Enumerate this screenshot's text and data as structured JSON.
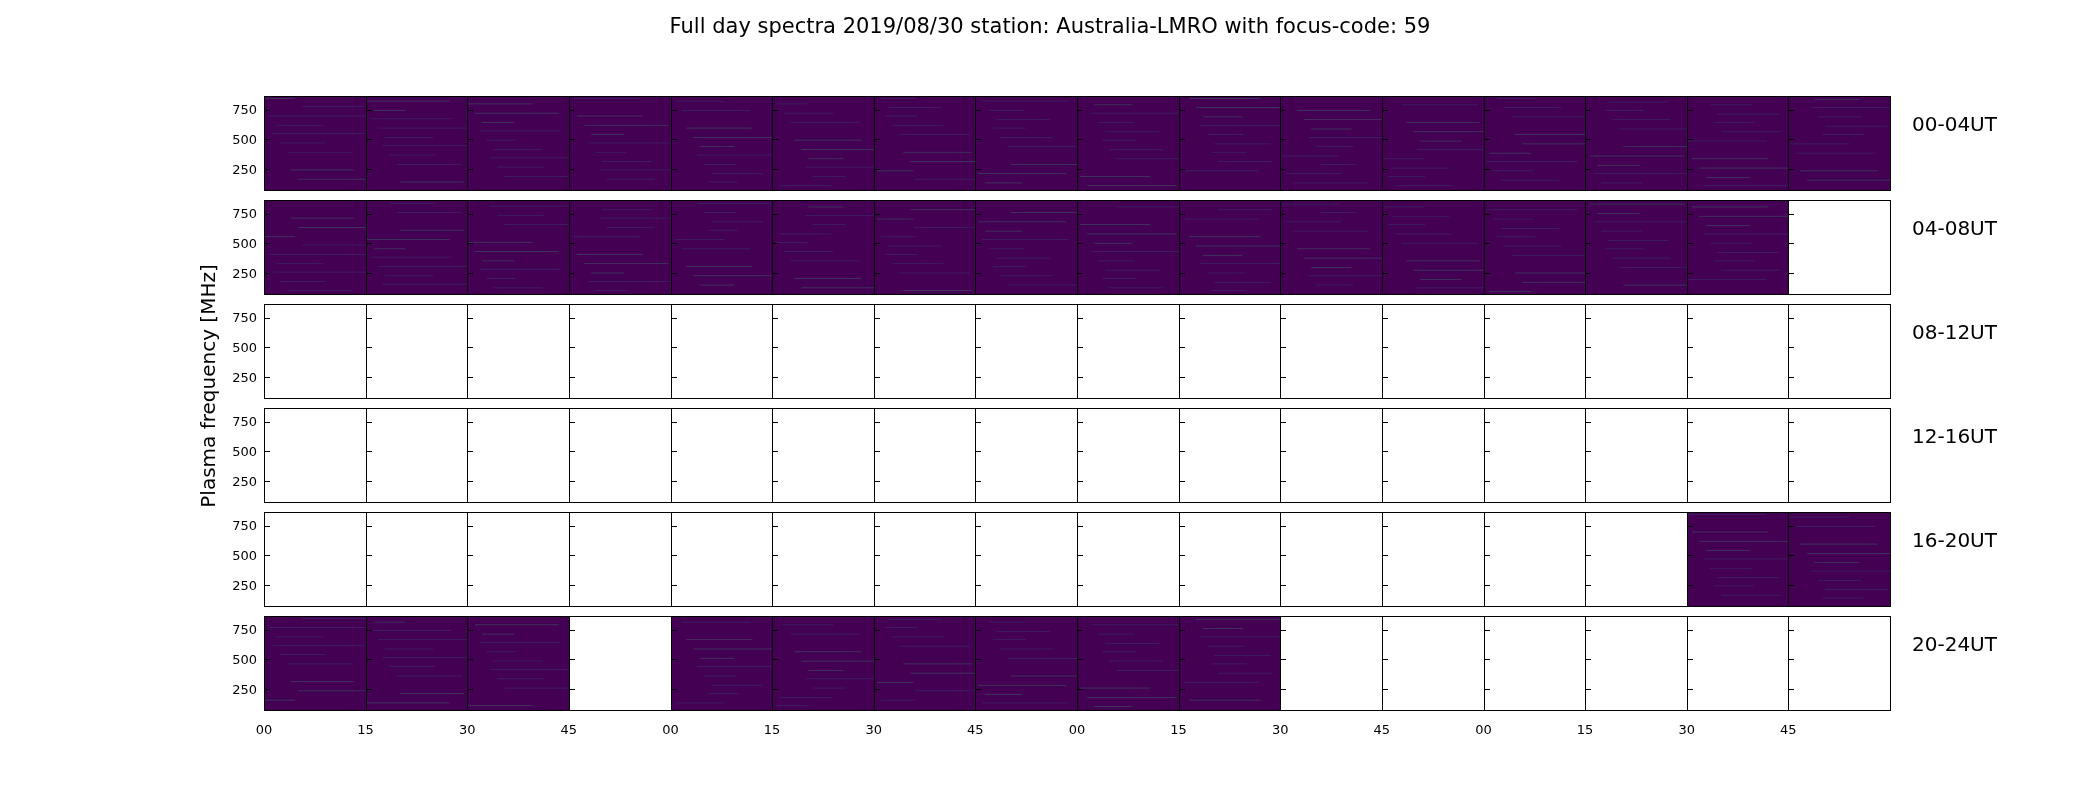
{
  "title": "Full day spectra 2019/08/30 station: Australia-LMRO with focus-code: 59",
  "y_axis": {
    "label": "Plasma frequency [MHz]"
  },
  "rows": [
    {
      "label": "00-04UT",
      "y_ticks": [
        "750",
        "500",
        "250"
      ],
      "panels": [
        {
          "has_data": true
        },
        {
          "has_data": true
        },
        {
          "has_data": true
        },
        {
          "has_data": true
        },
        {
          "has_data": true
        },
        {
          "has_data": true
        },
        {
          "has_data": true
        },
        {
          "has_data": true
        },
        {
          "has_data": true
        },
        {
          "has_data": true
        },
        {
          "has_data": true
        },
        {
          "has_data": true
        },
        {
          "has_data": true
        },
        {
          "has_data": true
        },
        {
          "has_data": true
        },
        {
          "has_data": true
        }
      ]
    },
    {
      "label": "04-08UT",
      "y_ticks": [
        "750",
        "500",
        "250"
      ],
      "panels": [
        {
          "has_data": true
        },
        {
          "has_data": true
        },
        {
          "has_data": true
        },
        {
          "has_data": true
        },
        {
          "has_data": true
        },
        {
          "has_data": true
        },
        {
          "has_data": true
        },
        {
          "has_data": true
        },
        {
          "has_data": true
        },
        {
          "has_data": true
        },
        {
          "has_data": true
        },
        {
          "has_data": true
        },
        {
          "has_data": true
        },
        {
          "has_data": true
        },
        {
          "has_data": true
        },
        {
          "has_data": false
        }
      ]
    },
    {
      "label": "08-12UT",
      "y_ticks": [
        "750",
        "500",
        "250"
      ],
      "panels": [
        {
          "has_data": false
        },
        {
          "has_data": false
        },
        {
          "has_data": false
        },
        {
          "has_data": false
        },
        {
          "has_data": false
        },
        {
          "has_data": false
        },
        {
          "has_data": false
        },
        {
          "has_data": false
        },
        {
          "has_data": false
        },
        {
          "has_data": false
        },
        {
          "has_data": false
        },
        {
          "has_data": false
        },
        {
          "has_data": false
        },
        {
          "has_data": false
        },
        {
          "has_data": false
        },
        {
          "has_data": false
        }
      ]
    },
    {
      "label": "12-16UT",
      "y_ticks": [
        "750",
        "500",
        "250"
      ],
      "panels": [
        {
          "has_data": false
        },
        {
          "has_data": false
        },
        {
          "has_data": false
        },
        {
          "has_data": false
        },
        {
          "has_data": false
        },
        {
          "has_data": false
        },
        {
          "has_data": false
        },
        {
          "has_data": false
        },
        {
          "has_data": false
        },
        {
          "has_data": false
        },
        {
          "has_data": false
        },
        {
          "has_data": false
        },
        {
          "has_data": false
        },
        {
          "has_data": false
        },
        {
          "has_data": false
        },
        {
          "has_data": false
        }
      ]
    },
    {
      "label": "16-20UT",
      "y_ticks": [
        "750",
        "500",
        "250"
      ],
      "panels": [
        {
          "has_data": false
        },
        {
          "has_data": false
        },
        {
          "has_data": false
        },
        {
          "has_data": false
        },
        {
          "has_data": false
        },
        {
          "has_data": false
        },
        {
          "has_data": false
        },
        {
          "has_data": false
        },
        {
          "has_data": false
        },
        {
          "has_data": false
        },
        {
          "has_data": false
        },
        {
          "has_data": false
        },
        {
          "has_data": false
        },
        {
          "has_data": false
        },
        {
          "has_data": true
        },
        {
          "has_data": true
        }
      ]
    },
    {
      "label": "20-24UT",
      "y_ticks": [
        "750",
        "500",
        "250"
      ],
      "panels": [
        {
          "has_data": true
        },
        {
          "has_data": true
        },
        {
          "has_data": true
        },
        {
          "has_data": false
        },
        {
          "has_data": true
        },
        {
          "has_data": true
        },
        {
          "has_data": true
        },
        {
          "has_data": true
        },
        {
          "has_data": true
        },
        {
          "has_data": true
        },
        {
          "has_data": false
        },
        {
          "has_data": false
        },
        {
          "has_data": false
        },
        {
          "has_data": false
        },
        {
          "has_data": false
        },
        {
          "has_data": false
        }
      ]
    }
  ],
  "x_ticks": [
    "00",
    "15",
    "30",
    "45",
    "00",
    "15",
    "30",
    "45",
    "00",
    "15",
    "30",
    "45",
    "00",
    "15",
    "30",
    "45"
  ]
}
